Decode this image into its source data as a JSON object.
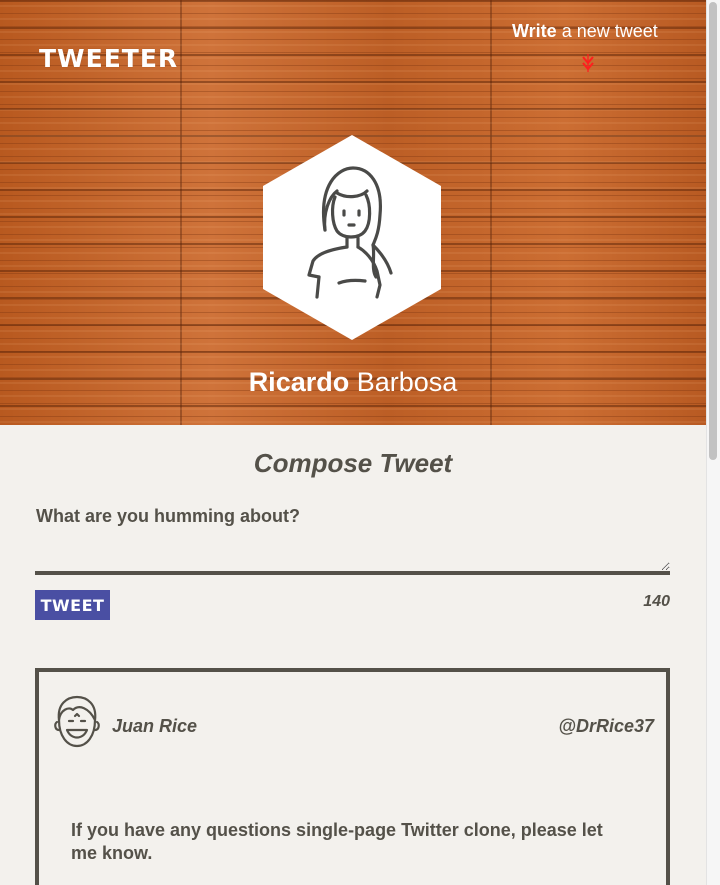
{
  "header": {
    "logo": "TWEETER",
    "nav_compose_bold": "Write",
    "nav_compose_rest": " a new tweet",
    "nav_arrow_icon": "double-chevron-down-icon",
    "nav_arrow_color": "#ff1e1e"
  },
  "profile": {
    "first_name": "Ricardo",
    "last_name": " Barbosa",
    "avatar_icon": "woman-avatar-icon"
  },
  "compose": {
    "title": "Compose Tweet",
    "prompt": "What are you humming about?",
    "textarea_value": "",
    "button_label": "TWEET",
    "button_color": "#4a4fa3",
    "char_counter": "140"
  },
  "tweets": [
    {
      "author": "Juan Rice",
      "handle": "@DrRice37",
      "avatar_icon": "smiling-man-avatar-icon",
      "text": "If you have any questions single-page Twitter clone, please let me know."
    }
  ],
  "colors": {
    "text_dark": "#545149",
    "page_bg": "#f3f1ed",
    "wood": "#c0652c"
  }
}
